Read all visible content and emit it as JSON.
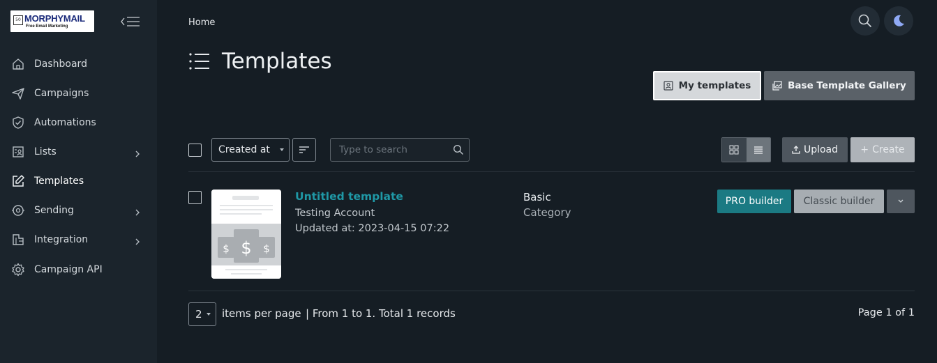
{
  "sidebar": {
    "logo": {
      "name": "MORPHYMAIL",
      "tagline": "Free Email Marketing",
      "mark": "50"
    },
    "items": [
      {
        "label": "Dashboard",
        "icon": "home-icon",
        "has_submenu": false
      },
      {
        "label": "Campaigns",
        "icon": "paper-plane-icon",
        "has_submenu": false
      },
      {
        "label": "Automations",
        "icon": "shield-check-icon",
        "has_submenu": false
      },
      {
        "label": "Lists",
        "icon": "contacts-list-icon",
        "has_submenu": true
      },
      {
        "label": "Templates",
        "icon": "edit-icon",
        "has_submenu": false,
        "active": true
      },
      {
        "label": "Sending",
        "icon": "sending-icon",
        "has_submenu": true
      },
      {
        "label": "Integration",
        "icon": "integration-icon",
        "has_submenu": true
      },
      {
        "label": "Campaign API",
        "icon": "gear-icon",
        "has_submenu": false
      }
    ]
  },
  "header": {
    "breadcrumb": "Home",
    "title": "Templates"
  },
  "tabs": {
    "my_templates": "My templates",
    "base_gallery": "Base Template Gallery"
  },
  "toolbar": {
    "sort_by": "Created at",
    "search_placeholder": "Type to search",
    "upload_label": "Upload",
    "create_label": "Create"
  },
  "templates": [
    {
      "name": "Untitled template",
      "owner": "Testing Account",
      "updated": "Updated at: 2023-04-15 07:22",
      "category": "Basic",
      "category_label": "Category",
      "pro_label": "PRO builder",
      "classic_label": "Classic builder"
    }
  ],
  "pagination": {
    "per_page": "2",
    "per_page_label": "items per page",
    "records": "| From 1 to 1. Total 1 records",
    "page": "Page 1 of 1"
  },
  "colors": {
    "background": "#151d24",
    "sidebar": "#1b242c",
    "accent": "#1b7a83",
    "link": "#1f98a6"
  }
}
